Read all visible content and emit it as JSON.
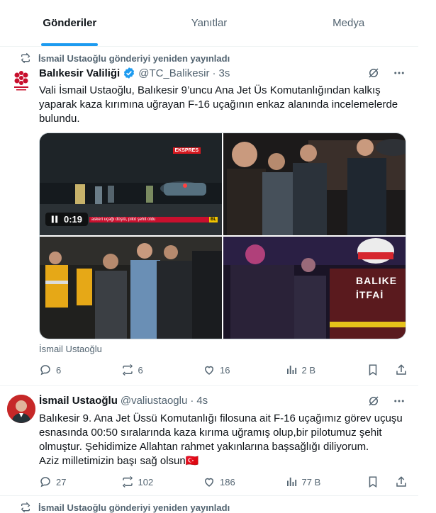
{
  "tabs": [
    {
      "label": "Gönderiler",
      "active": true
    },
    {
      "label": "Yanıtlar",
      "active": false
    },
    {
      "label": "Medya",
      "active": false
    }
  ],
  "tweet1": {
    "retweet_text": "İsmail Ustaoğlu gönderiyi yeniden yayınladı",
    "name": "Balıkesir Valiliği",
    "handle": "@TC_Balikesir",
    "time": "3s",
    "text": "Vali İsmail Ustaoğlu, Balıkesir 9’uncu Ana Jet Üs Komutanlığından kalkış yaparak kaza kırımına uğrayan F-16 uçağının enkaz alanında incelemelerde bulundu.",
    "video": {
      "duration": "0:19",
      "channel_logo": "EKSPRES",
      "ticker": "askeri uçağı düştü, pilot şehit oldu",
      "corner_badge": "BL"
    },
    "photo4_text_line1": "BALIKE",
    "photo4_text_line2": "İTFAİ",
    "attribution": "İsmail Ustaoğlu",
    "stats": {
      "replies": "6",
      "retweets": "6",
      "likes": "16",
      "views": "2 B"
    }
  },
  "tweet2": {
    "name": "İsmail Ustaoğlu",
    "handle": "@valiustaoglu",
    "time": "4s",
    "text": "Balıkesir 9. Ana Jet Üssü Komutanlığı filosuna ait F-16 uçağımız görev uçuşu esnasında 00:50 sıralarında kaza kırıma uğramış olup,bir pilotumuz şehit olmuştur. Şehidimize Allahtan rahmet yakınlarına başsağlığı diliyorum.",
    "text_line2": "Aziz milletimizin başı sağ olsun🇹🇷",
    "stats": {
      "replies": "27",
      "retweets": "102",
      "likes": "186",
      "views": "77 B"
    }
  },
  "tweet3": {
    "retweet_text": "İsmail Ustaoğlu gönderiyi yeniden yayınladı"
  },
  "colors": {
    "accent": "#1d9bf0",
    "muted": "#536471",
    "text": "#0f1419",
    "flag": "#e30a17"
  }
}
